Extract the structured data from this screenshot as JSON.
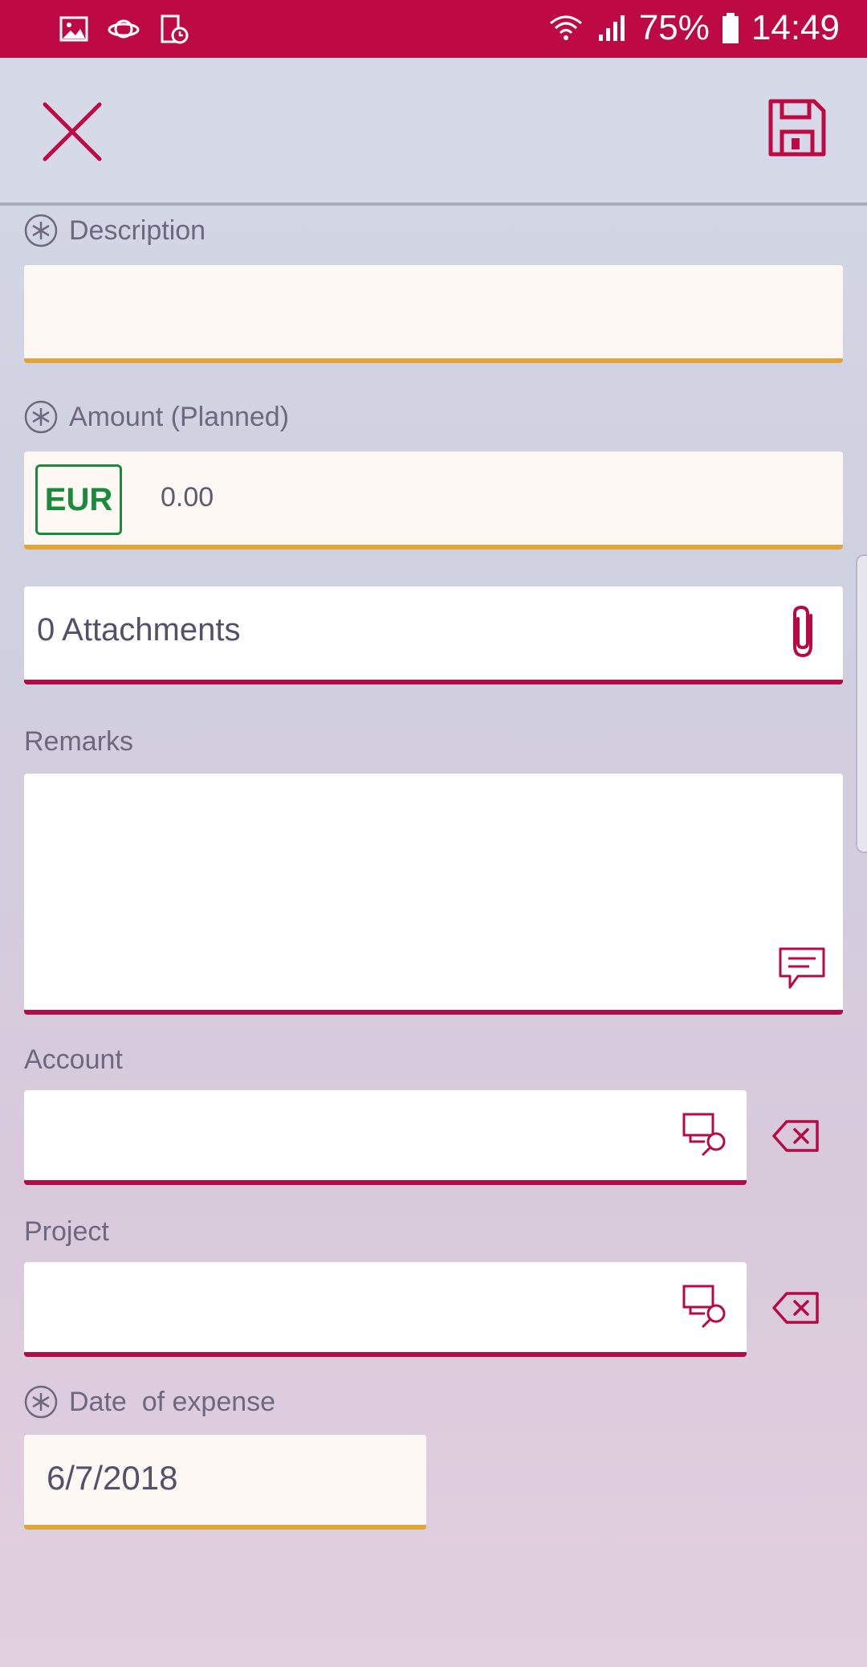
{
  "status_bar": {
    "battery": "75%",
    "time": "14:49",
    "icons": [
      "gallery-icon",
      "planet-icon",
      "schedule-icon",
      "wifi-icon",
      "signal-icon",
      "battery-icon"
    ]
  },
  "toolbar": {
    "close_icon": "close-icon",
    "save_icon": "save-icon"
  },
  "form": {
    "description": {
      "label": "Description",
      "value": ""
    },
    "amount": {
      "label": "Amount (Planned)",
      "currency": "EUR",
      "value": "0.00"
    },
    "attachments": {
      "text": "0 Attachments",
      "icon": "paperclip-icon"
    },
    "remarks": {
      "label": "Remarks",
      "value": "",
      "icon": "comment-icon"
    },
    "account": {
      "label": "Account",
      "value": "",
      "lookup_icon": "lookup-icon",
      "clear_icon": "clear-icon"
    },
    "project": {
      "label": "Project",
      "value": "",
      "lookup_icon": "lookup-icon",
      "clear_icon": "clear-icon"
    },
    "date": {
      "label": "Date  of expense",
      "value": "6/7/2018"
    }
  },
  "colors": {
    "brand": "#be0a43",
    "required_underline": "#e2a53a",
    "field_underline": "#b50a45",
    "currency_green": "#1a8a3c"
  }
}
